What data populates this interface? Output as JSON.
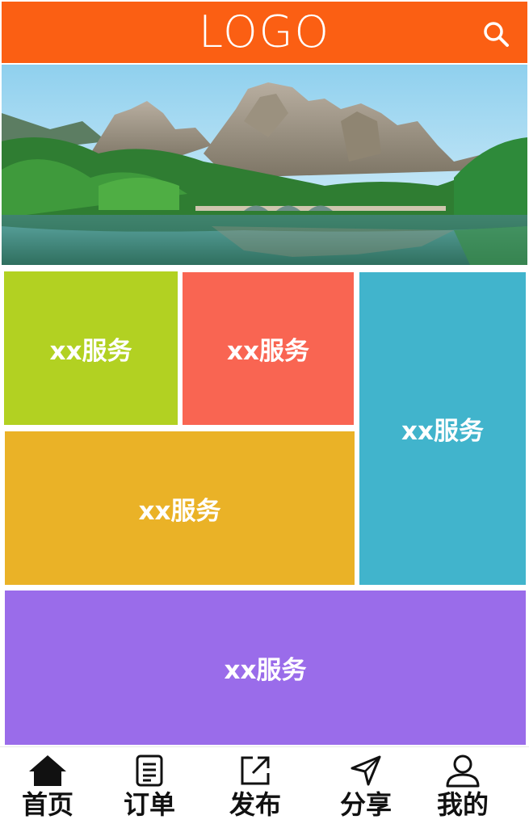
{
  "header": {
    "logo_text": "LOGO",
    "background": "#fb5f13",
    "search_icon": "search-icon"
  },
  "banner": {
    "description_icon": "landscape-photo"
  },
  "tiles": [
    {
      "label": "xx服务",
      "color": "#b2d122"
    },
    {
      "label": "xx服务",
      "color": "#f96552"
    },
    {
      "label": "xx服务",
      "color": "#41b4cc"
    },
    {
      "label": "xx服务",
      "color": "#eab227"
    },
    {
      "label": "xx服务",
      "color": "#9a6cea"
    }
  ],
  "nav": {
    "items": [
      {
        "label": "首页",
        "icon": "home-icon"
      },
      {
        "label": "订单",
        "icon": "document-icon"
      },
      {
        "label": "发布",
        "icon": "share-external-icon"
      },
      {
        "label": "分享",
        "icon": "send-icon"
      },
      {
        "label": "我的",
        "icon": "user-icon"
      }
    ]
  }
}
